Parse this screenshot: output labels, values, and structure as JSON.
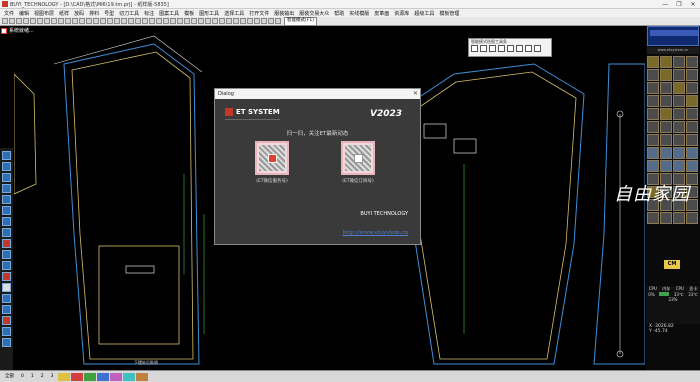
{
  "window": {
    "title": "BUYI_TECHNOLOGY - [D:\\CAD\\格式\\MI6\\19.tm.prj] - 纸样版-5835]",
    "controls": [
      "—",
      "❐",
      "✕"
    ]
  },
  "menu": [
    "文件",
    "编辑",
    "视图布层",
    "纸样",
    "放码",
    "排料",
    "号型",
    "切刀工具",
    "标注",
    "图案工具",
    "模板",
    "图形工具",
    "选择工具",
    "打开文件",
    "服装输出",
    "服装交易大众",
    "帮助",
    "实线模版",
    "皮革面",
    "资源库",
    "超级工具",
    "模板管理"
  ],
  "toolbar": {
    "mode_combo": "智能模式(F1)"
  },
  "status_strip": {
    "mode_label": "系统就绪..."
  },
  "float_toolbar": {
    "title": "智能模式绘图工具条"
  },
  "dialog": {
    "title": "Dialog",
    "close": "✕",
    "brand": "ET SYSTEM",
    "version": "V2023",
    "prompt": "扫一扫，关注ET最新动态",
    "qr_left_caption": "(ET微信服务号)",
    "qr_right_caption": "(ET微信订阅号)",
    "company": "BUYI  TECHNOLOGY",
    "url": "http://www.etsystem.cn"
  },
  "right_panel": {
    "url": "www.etsystem.cn",
    "cm_label": "CM"
  },
  "sysmon": {
    "cpu_label": "CPU",
    "mem_label": "内存",
    "cpu2_label": "CPU",
    "gpu_label": "显卡",
    "cpu_value": "0%",
    "mem_value": "23%",
    "temp1": "33℃",
    "temp2": "33℃"
  },
  "coords": {
    "x_label": "X",
    "x_value": "-3026.82",
    "y_label": "Y",
    "y_value": "-45.74"
  },
  "watermark": "自由家园",
  "bottom": {
    "items": [
      "全部",
      "0",
      "1",
      "2",
      "3"
    ],
    "swatches": [
      "#e0c040",
      "#d04040",
      "#40a040",
      "#4070d0",
      "#c060c0",
      "#40c0c0",
      "#c08040"
    ]
  },
  "canvas": {
    "label_left": "布纹线",
    "label_pocket": "下摆处后贴袋"
  }
}
